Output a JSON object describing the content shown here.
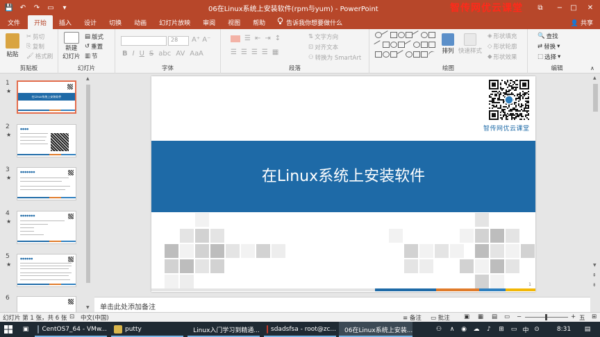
{
  "window": {
    "title": "06在Linux系统上安装软件(rpm与yum)  -  PowerPoint",
    "brand_overlay": "智传网优云课堂",
    "controls": {
      "minimize": "−",
      "maximize": "□",
      "close": "✕",
      "ribbon_toggle": "⧉"
    }
  },
  "qat": {
    "save": "💾",
    "undo": "↶",
    "redo": "↷",
    "present": "▭",
    "more": "▾"
  },
  "tabs": [
    "文件",
    "开始",
    "插入",
    "设计",
    "切换",
    "动画",
    "幻灯片放映",
    "审阅",
    "视图",
    "帮助"
  ],
  "active_tab": "开始",
  "tell_me": "告诉我你想要做什么",
  "share": "共享",
  "ribbon": {
    "clipboard": {
      "paste": "粘贴",
      "cut": "剪切",
      "copy": "复制",
      "format_painter": "格式刷",
      "label": "剪贴板"
    },
    "slides": {
      "new_slide": "新建",
      "new_slide2": "幻灯片",
      "layout": "版式",
      "reset": "重置",
      "section": "节",
      "label": "幻灯片"
    },
    "font": {
      "font_name": "",
      "font_size": "28",
      "label": "字体"
    },
    "paragraph": {
      "text_direction": "文字方向",
      "align_text": "对齐文本",
      "smartart": "转换为 SmartArt",
      "label": "段落"
    },
    "drawing": {
      "arrange": "排列",
      "quick_styles": "快速样式",
      "fill": "形状填充",
      "outline": "形状轮廓",
      "effects": "形状效果",
      "label": "绘图"
    },
    "editing": {
      "find": "查找",
      "replace": "替换",
      "select": "选择",
      "label": "编辑"
    }
  },
  "thumbnails": [
    {
      "num": "1",
      "star": "★",
      "title": "在Linux系统上安装软件"
    },
    {
      "num": "2",
      "star": "★",
      "title": ""
    },
    {
      "num": "3",
      "star": "★",
      "title": ""
    },
    {
      "num": "4",
      "star": "★",
      "title": ""
    },
    {
      "num": "5",
      "star": "★",
      "title": ""
    },
    {
      "num": "6",
      "star": "",
      "title": ""
    }
  ],
  "slide": {
    "title": "在Linux系统上安装软件",
    "brand": "智传网优云课堂",
    "page": "1"
  },
  "notes_placeholder": "单击此处添加备注",
  "status": {
    "slide_info": "幻灯片 第 1 张，共 6 张",
    "language": "中文(中国)",
    "notes": "备注",
    "comments": "批注",
    "zoom": "五"
  },
  "taskbar": {
    "items": [
      "CentOS7_64 - VMw...",
      "putty",
      "Linux入门学习到精通...",
      "sdadsfsa - root@zc...",
      "06在Linux系统上安装..."
    ],
    "ime": "中",
    "time": "8:31"
  },
  "colors": {
    "brand": "#b7472a",
    "slide_blue": "#1e6aa7",
    "accent_orange": "#e07b2a"
  }
}
